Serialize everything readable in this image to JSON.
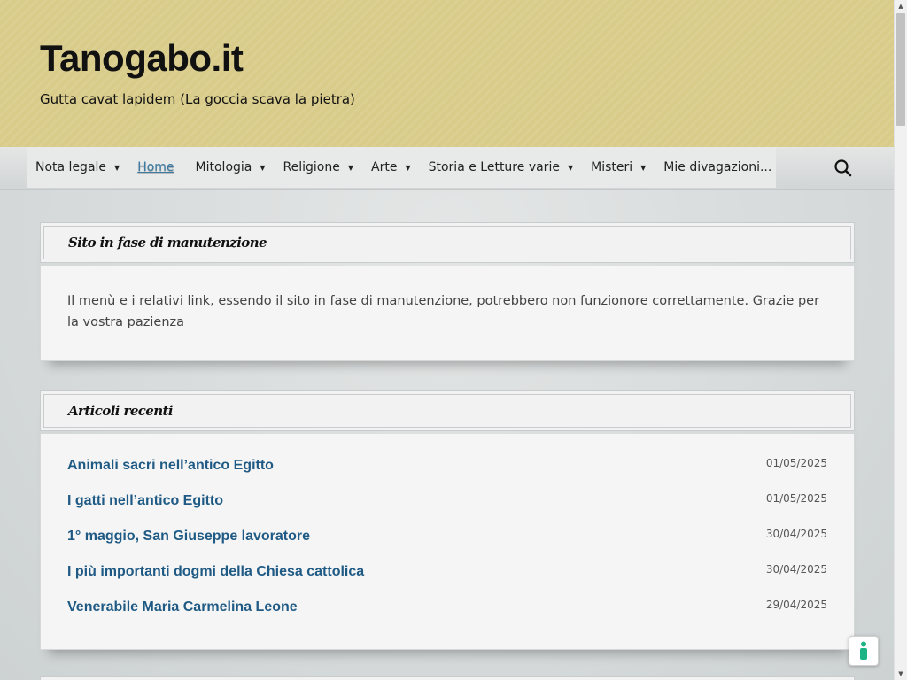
{
  "header": {
    "site_title": "Tanogabo.it",
    "site_description": "Gutta cavat lapidem (La goccia scava la pietra)"
  },
  "nav": {
    "items": [
      {
        "label": "Nota legale",
        "has_submenu": true
      },
      {
        "label": "Home",
        "has_submenu": false,
        "current": true
      },
      {
        "label": "Mitologia",
        "has_submenu": true
      },
      {
        "label": "Religione",
        "has_submenu": true
      },
      {
        "label": "Arte",
        "has_submenu": true
      },
      {
        "label": "Storia e Letture varie",
        "has_submenu": true
      },
      {
        "label": "Misteri",
        "has_submenu": true
      },
      {
        "label": "Mie divagazioni...",
        "has_submenu": false
      }
    ],
    "caret": "▼",
    "search_icon": "search-icon"
  },
  "notice_widget": {
    "title": "Sito in fase di manutenzione",
    "text": "Il menù e i relativi link, essendo il sito in fase di manutenzione, potrebbero non funzionore correttamente. Grazie per la vostra pazienza"
  },
  "recent_posts": {
    "title": "Articoli recenti",
    "posts": [
      {
        "title": "Animali sacri nell’antico Egitto",
        "date": "01/05/2025"
      },
      {
        "title": "I gatti nell’antico Egitto",
        "date": "01/05/2025"
      },
      {
        "title": "1° maggio, San Giuseppe lavoratore",
        "date": "30/04/2025"
      },
      {
        "title": "I più importanti dogmi della Chiesa cattolica",
        "date": "30/04/2025"
      },
      {
        "title": "Venerabile Maria Carmelina Leone",
        "date": "29/04/2025"
      }
    ]
  },
  "scrollbar": {
    "up_arrow": "▲",
    "down_arrow": "▼"
  },
  "floating_button": {
    "icon": "privacy-icon",
    "accent_color": "#1db384"
  },
  "colors": {
    "header_bg": "#d9cc8a",
    "link": "#1f5a85",
    "current_menu": "#3a7aa3"
  }
}
